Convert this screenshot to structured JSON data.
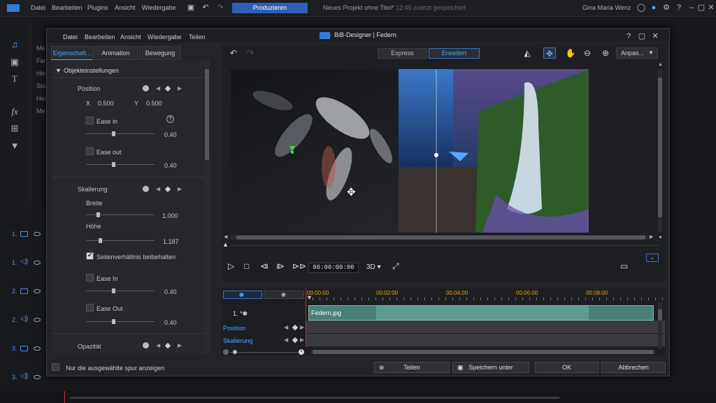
{
  "app": {
    "menu": [
      "Datei",
      "Bearbeiten",
      "Plugins",
      "Ansicht",
      "Wiedergabe"
    ],
    "produce_button": "Produzieren",
    "project_title": "Neues Projekt ohne Titel*",
    "project_saved": "12:45 zuletzt gespeichert",
    "user_name": "Gina Maria Wenz",
    "left_labels": [
      "Me",
      "Far",
      "Hin",
      "Sou",
      "Hei",
      "Me"
    ],
    "tracks": [
      {
        "label": "1."
      },
      {
        "label": "1."
      },
      {
        "label": "2."
      },
      {
        "label": "2."
      },
      {
        "label": "3."
      },
      {
        "label": "3."
      }
    ]
  },
  "dialog": {
    "title": "BiB-Designer  |  Federn",
    "menu": [
      "Datei",
      "Bearbeiten",
      "Ansicht",
      "Wiedergabe",
      "Teilen"
    ],
    "tabs": [
      "Eigenschaft...",
      "Animation",
      "Bewegung"
    ],
    "active_tab": 0,
    "properties": {
      "section_title": "Objekteinstellungen",
      "position": {
        "label": "Position",
        "x_label": "X",
        "x_value": "0.500",
        "y_label": "Y",
        "y_value": "0.500",
        "ease_in_label": "Ease in",
        "ease_in_value": "0.40",
        "ease_out_label": "Ease out",
        "ease_out_value": "0.40"
      },
      "scaling": {
        "label": "Skalierung",
        "width_label": "Breite",
        "width_value": "1.000",
        "height_label": "Höhe",
        "height_value": "1.187",
        "keep_ratio_label": "Seitenverhältnis beibehalten",
        "keep_ratio": true,
        "ease_in_label": "Ease In",
        "ease_in_value": "0.40",
        "ease_out_label": "Ease Out",
        "ease_out_value": "0.40"
      },
      "opacity_label": "Opazität"
    },
    "mode_buttons": [
      "Express",
      "Erweitert"
    ],
    "active_mode": 1,
    "zoom_select": "Anpas...",
    "timecode": "00:00:00:00",
    "view_3d": "3D",
    "ruler_ticks": [
      "00:00:00",
      "00:02:00",
      "00:04:00",
      "00:06:00",
      "00:08:00"
    ],
    "clip_name": "Federn.jpg",
    "track_name": "1.  *✱",
    "track_rows": [
      "Position",
      "Skalierung"
    ],
    "only_selected_label": "Nur die ausgewählte spur anzeigen",
    "buttons": {
      "share": "Teilen",
      "save_as": "Speichern unter",
      "ok": "OK",
      "cancel": "Abbrechen"
    }
  }
}
